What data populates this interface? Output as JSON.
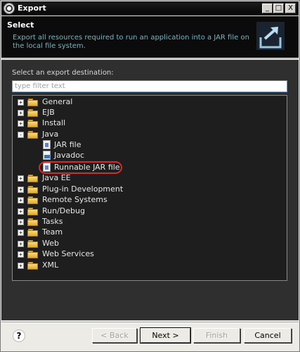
{
  "window": {
    "title": "Export"
  },
  "titlebar_buttons": {
    "minimize": "_",
    "maximize": "□",
    "close": "X"
  },
  "header": {
    "title": "Select",
    "description": "Export all resources required to run an application into a JAR file on the local file system."
  },
  "destination_label": "Select an export destination:",
  "filter": {
    "placeholder": "type filter text",
    "value": ""
  },
  "tree": {
    "items": [
      {
        "label": "General",
        "expanded": false
      },
      {
        "label": "EJB",
        "expanded": false
      },
      {
        "label": "Install",
        "expanded": false
      },
      {
        "label": "Java",
        "expanded": true,
        "children": [
          {
            "label": "JAR file",
            "icon": "jar-file-icon"
          },
          {
            "label": "Javadoc",
            "icon": "javadoc-icon"
          },
          {
            "label": "Runnable JAR file",
            "icon": "runnable-jar-icon",
            "selected": true
          }
        ]
      },
      {
        "label": "Java EE",
        "expanded": false
      },
      {
        "label": "Plug-in Development",
        "expanded": false
      },
      {
        "label": "Remote Systems",
        "expanded": false
      },
      {
        "label": "Run/Debug",
        "expanded": false
      },
      {
        "label": "Tasks",
        "expanded": false
      },
      {
        "label": "Team",
        "expanded": false
      },
      {
        "label": "Web",
        "expanded": false
      },
      {
        "label": "Web Services",
        "expanded": false
      },
      {
        "label": "XML",
        "expanded": false
      }
    ]
  },
  "expander": {
    "collapsed": "+",
    "expanded": "-"
  },
  "buttons": {
    "help": "?",
    "back": "< Back",
    "next": "Next >",
    "finish": "Finish",
    "cancel": "Cancel"
  },
  "colors": {
    "header_bg": "#0b0b0b",
    "header_desc": "#6fb6c7",
    "highlight": "#d62b2b",
    "folder": "#e9b73a"
  }
}
